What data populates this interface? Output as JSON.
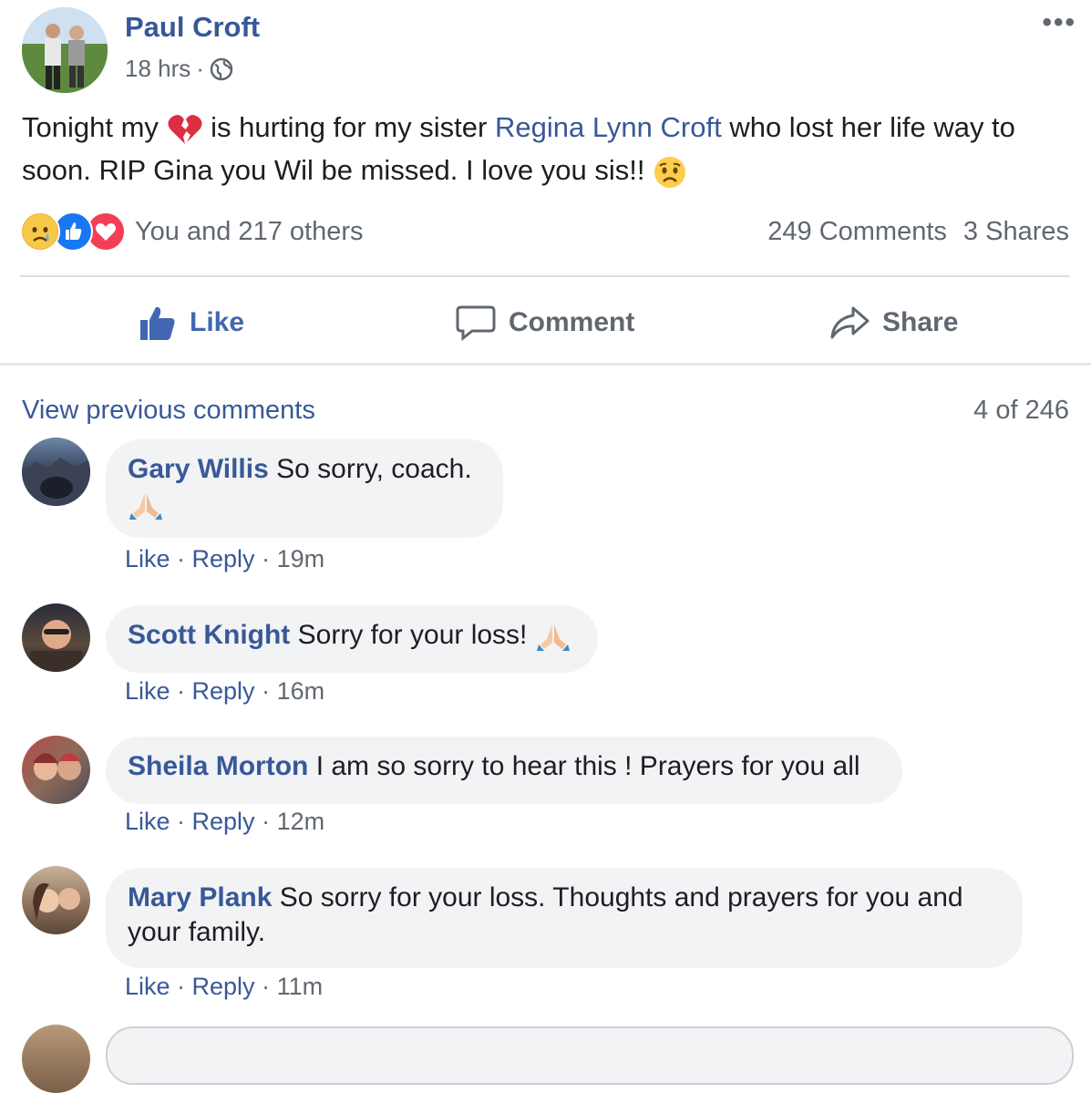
{
  "post": {
    "author": "Paul Croft",
    "time": "18 hrs",
    "separator": "·",
    "text_part1": "Tonight my",
    "text_part2": "is hurting for my sister",
    "mention": "Regina Lynn Croft",
    "text_part3": "who lost her life way to soon. RIP Gina you Wil be missed. I love you sis!!",
    "reactions_text": "You and 217 others",
    "comments_count": "249 Comments",
    "shares_count": "3 Shares",
    "more_label": "•••"
  },
  "actions": {
    "like": "Like",
    "comment": "Comment",
    "share": "Share"
  },
  "comments_header": {
    "view_previous": "View previous comments",
    "pager": "4 of 246"
  },
  "comments": [
    {
      "name": "Gary Willis",
      "text": "So sorry, coach.",
      "like": "Like",
      "reply": "Reply",
      "time": "19m"
    },
    {
      "name": "Scott Knight",
      "text": "Sorry for your loss!",
      "like": "Like",
      "reply": "Reply",
      "time": "16m"
    },
    {
      "name": "Sheila Morton",
      "text": "I am so sorry to hear this ! Prayers for you all",
      "like": "Like",
      "reply": "Reply",
      "time": "12m"
    },
    {
      "name": "Mary Plank",
      "text": "So sorry for your loss. Thoughts and prayers for you and your family.",
      "like": "Like",
      "reply": "Reply",
      "time": "11m"
    }
  ],
  "colors": {
    "link": "#385898",
    "muted": "#606770",
    "bubble": "#f2f3f5",
    "like_blue": "#4267b2"
  },
  "icons": [
    "globe-icon",
    "broken-heart-icon",
    "sad-face-icon",
    "like-reaction-icon",
    "love-reaction-icon",
    "thumbs-up-icon",
    "comment-icon",
    "share-icon",
    "praying-hands-icon"
  ]
}
